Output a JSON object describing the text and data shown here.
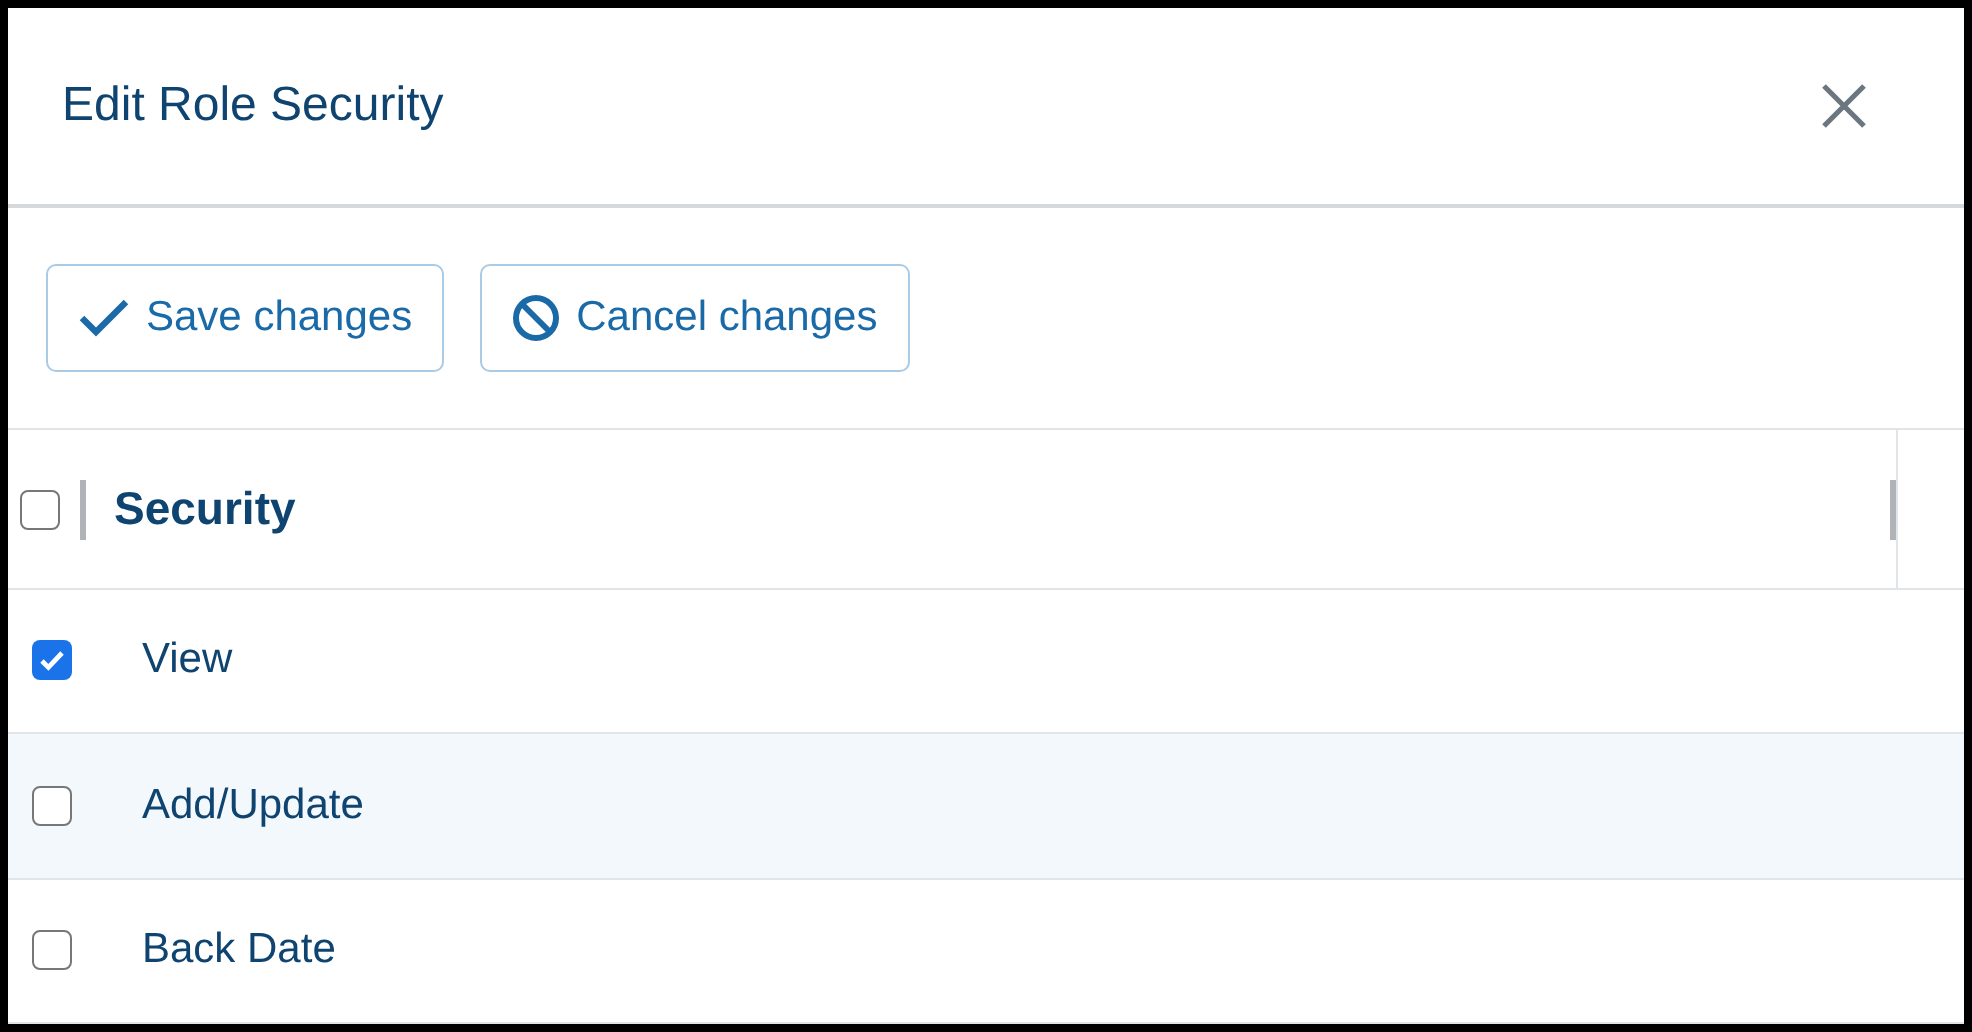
{
  "dialog": {
    "title": "Edit Role Security"
  },
  "toolbar": {
    "buttons": [
      {
        "kind": "save",
        "label": "Save changes"
      },
      {
        "kind": "cancel",
        "label": "Cancel changes"
      }
    ]
  },
  "table": {
    "select_all": {
      "checked": false
    },
    "columns": [
      "Security"
    ],
    "rows": [
      {
        "label": "View",
        "checked": true,
        "highlighted": false
      },
      {
        "label": "Add/Update",
        "checked": false,
        "highlighted": true
      },
      {
        "label": "Back Date",
        "checked": false,
        "highlighted": false
      }
    ]
  }
}
